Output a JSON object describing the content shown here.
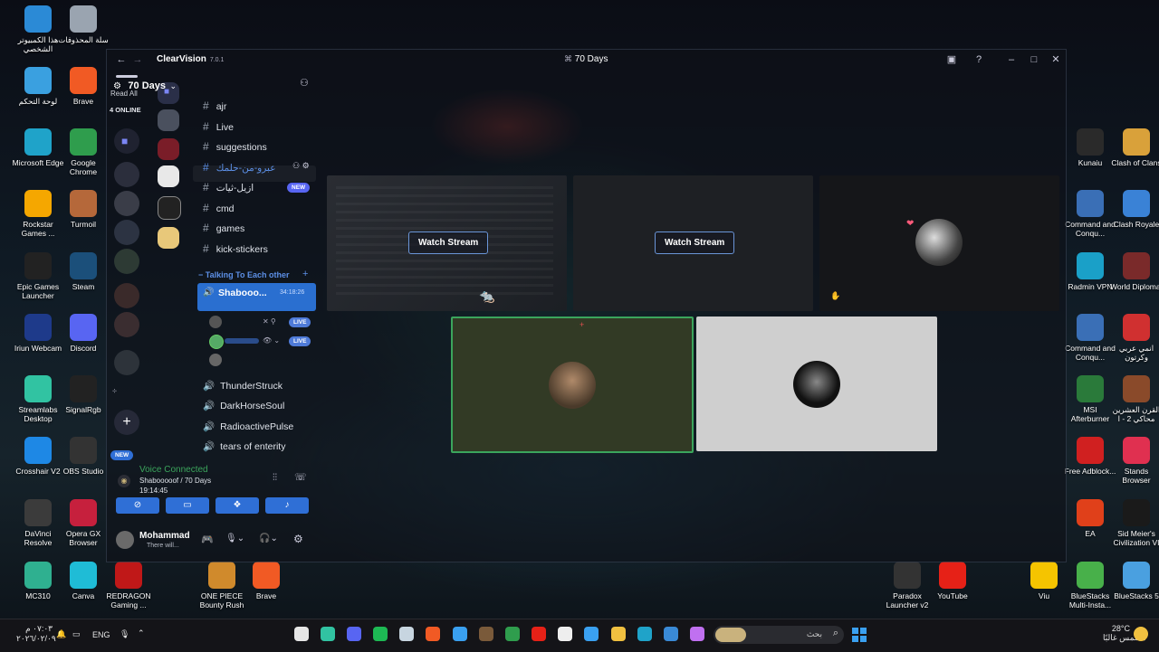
{
  "desktop_left": [
    {
      "label": "هذا الكمبيوتر الشخصي",
      "icon": "computer-icon",
      "color": "#2b8ad6"
    },
    {
      "label": "سلة المحذوفات",
      "icon": "recycle-bin-icon",
      "color": "#9aa4b0"
    },
    {
      "label": "لوحة التحكم",
      "icon": "control-panel-icon",
      "color": "#3aa0e0"
    },
    {
      "label": "Brave",
      "icon": "brave-icon",
      "color": "#f15a24"
    },
    {
      "label": "Microsoft Edge",
      "icon": "edge-icon",
      "color": "#1fa3c9"
    },
    {
      "label": "Google Chrome",
      "icon": "chrome-icon",
      "color": "#2f9d4d"
    },
    {
      "label": "Rockstar Games ...",
      "icon": "rockstar-icon",
      "color": "#f5a700"
    },
    {
      "label": "Turmoil",
      "icon": "turmoil-icon",
      "color": "#b5683a"
    },
    {
      "label": "Epic Games Launcher",
      "icon": "epic-games-icon",
      "color": "#222222"
    },
    {
      "label": "Steam",
      "icon": "steam-icon",
      "color": "#1b4f7a"
    },
    {
      "label": "Iriun Webcam",
      "icon": "webcam-icon",
      "color": "#1e3a8a"
    },
    {
      "label": "Discord",
      "icon": "discord-icon",
      "color": "#5865f2"
    },
    {
      "label": "Streamlabs Desktop",
      "icon": "streamlabs-icon",
      "color": "#31c3a2"
    },
    {
      "label": "SignalRgb",
      "icon": "signalrgb-icon",
      "color": "#222222"
    },
    {
      "label": "Crosshair V2",
      "icon": "crosshair-icon",
      "color": "#1e88e5"
    },
    {
      "label": "OBS Studio",
      "icon": "obs-icon",
      "color": "#333333"
    },
    {
      "label": "DaVinci Resolve",
      "icon": "davinci-icon",
      "color": "#3b3b3b"
    },
    {
      "label": "Opera GX Browser",
      "icon": "opera-gx-icon",
      "color": "#c6203d"
    },
    {
      "label": "MC310",
      "icon": "mc310-icon",
      "color": "#2fb090"
    },
    {
      "label": "Canva",
      "icon": "canva-icon",
      "color": "#1fbcd6"
    },
    {
      "label": "REDRAGON Gaming ...",
      "icon": "redragon-icon",
      "color": "#c01818"
    },
    {
      "label": "ONE PIECE Bounty Rush",
      "icon": "onepiece-icon",
      "color": "#d08a2c"
    },
    {
      "label": "Brave",
      "icon": "brave-icon",
      "color": "#f15a24"
    }
  ],
  "desktop_right": [
    {
      "label": "Kunaiu",
      "icon": "kunaiu-icon",
      "color": "#2a2a2a"
    },
    {
      "label": "Clash of Clans",
      "icon": "clash-of-clans-icon",
      "color": "#d9a13a"
    },
    {
      "label": "Command and Conqu...",
      "icon": "command-conquer-icon",
      "color": "#3a6fb6"
    },
    {
      "label": "Clash Royale",
      "icon": "clash-royale-icon",
      "color": "#3a82d6"
    },
    {
      "label": "Radmin VPN",
      "icon": "radmin-icon",
      "color": "#1aa0c8"
    },
    {
      "label": "World Diplomat",
      "icon": "world-diplomat-icon",
      "color": "#7a2a2a"
    },
    {
      "label": "Command and Conqu...",
      "icon": "command-conquer-icon",
      "color": "#3a6fb6"
    },
    {
      "label": "انمي عربي وكرتون",
      "icon": "anime-icon",
      "color": "#d03030"
    },
    {
      "label": "MSI Afterburner",
      "icon": "msi-icon",
      "color": "#2a7a3a"
    },
    {
      "label": "القرن العشرين محاكي 2 - ا",
      "icon": "century-icon",
      "color": "#8a4a2a"
    },
    {
      "label": "Free Adblock...",
      "icon": "adblock-icon",
      "color": "#d02020"
    },
    {
      "label": "Stands Browser",
      "icon": "stands-icon",
      "color": "#e03050"
    },
    {
      "label": "EA",
      "icon": "ea-icon",
      "color": "#e0401a"
    },
    {
      "label": "Sid Meier's Civilization VI",
      "icon": "civ-icon",
      "color": "#1a1a1a"
    },
    {
      "label": "Paradox Launcher v2",
      "icon": "paradox-icon",
      "color": "#333333"
    },
    {
      "label": "YouTube",
      "icon": "youtube-icon",
      "color": "#e62117"
    },
    {
      "label": "Viu",
      "icon": "viu-icon",
      "color": "#f5c400"
    },
    {
      "label": "BlueStacks Multi-Insta...",
      "icon": "bluestacks-multi-icon",
      "color": "#48b04a"
    },
    {
      "label": "BlueStacks 5",
      "icon": "bluestacks-icon",
      "color": "#4aa0e0"
    }
  ],
  "window": {
    "app_name": "ClearVision",
    "app_version": "7.0.1",
    "title": "70 Days"
  },
  "rail": {
    "read_all": "Read All",
    "online": "4 ONLINE",
    "new_badge": "NEW"
  },
  "server": {
    "name": "70 Days",
    "text_channels": [
      {
        "name": "ajr"
      },
      {
        "name": "Live"
      },
      {
        "name": "suggestions"
      },
      {
        "name": "عبرو-من-حلمك"
      },
      {
        "name": "ازيل-ثيات"
      },
      {
        "name": "cmd"
      },
      {
        "name": "games"
      },
      {
        "name": "kick-stickers"
      }
    ],
    "new_label": "NEW",
    "category": "Talking To Each other",
    "active_voice": {
      "name": "Shabooo...",
      "time": "34:18:26"
    },
    "live_label": "LIVE",
    "voice_channels": [
      {
        "name": "ThunderStruck"
      },
      {
        "name": "DarkHorseSoul"
      },
      {
        "name": "RadioactivePulse"
      },
      {
        "name": "tears of enterity"
      }
    ]
  },
  "voice_panel": {
    "status": "Voice Connected",
    "channel": "Shabooooof / 70 Days",
    "time": "19:14:45"
  },
  "user": {
    "name": "Mohammad",
    "status": "There will..."
  },
  "stage": {
    "watch_label": "Watch Stream"
  },
  "taskbar": {
    "clock_time": "٠٧:٠٣ م",
    "clock_date": "٢٠٢٦/٠٢/٠٩",
    "lang": "ENG",
    "search_placeholder": "بحث",
    "weather_temp": "28°C",
    "weather_desc": "مشمس غالبًا"
  }
}
